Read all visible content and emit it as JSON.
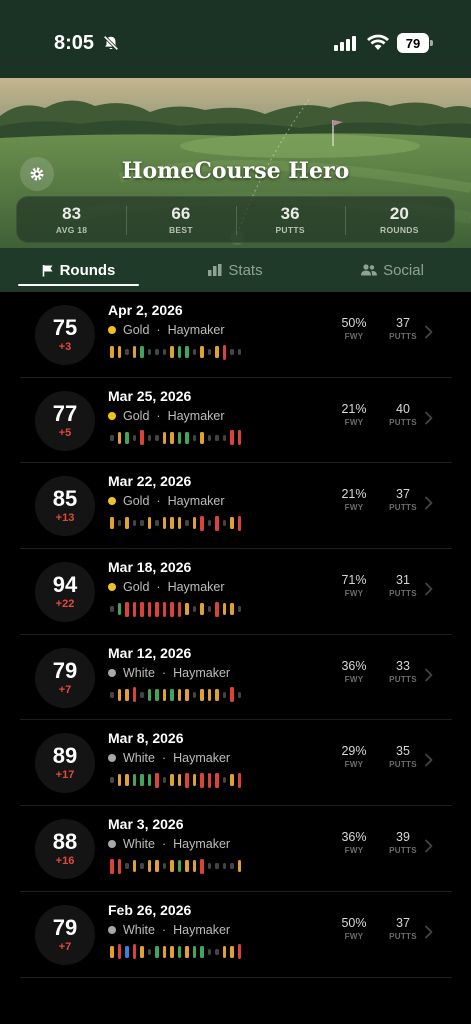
{
  "status_bar": {
    "time": "8:05",
    "battery": "79"
  },
  "app": {
    "title": "HomeCourse Hero"
  },
  "summary": [
    {
      "value": "83",
      "label": "AVG 18"
    },
    {
      "value": "66",
      "label": "BEST"
    },
    {
      "value": "36",
      "label": "PUTTS"
    },
    {
      "value": "20",
      "label": "ROUNDS"
    }
  ],
  "tabs": [
    {
      "label": "Rounds",
      "icon": "flag-icon",
      "active": true
    },
    {
      "label": "Stats",
      "icon": "bar-chart-icon",
      "active": false
    },
    {
      "label": "Social",
      "icon": "people-icon",
      "active": false
    }
  ],
  "colors": {
    "eagle": "#3b7fd6",
    "birdie": "#3fa65a",
    "par": "#444444",
    "bogey": "#e0a12f",
    "double": "#d9433a",
    "gold_tee": "#f2c21b",
    "white_tee": "#a8a8a8"
  },
  "rounds": [
    {
      "score": "75",
      "diff": "+3",
      "date": "Apr 2, 2026",
      "tee": "Gold",
      "tee_color": "#f2c21b",
      "course": "Haymaker",
      "fwy": "50%",
      "putts": "37",
      "holes": [
        "bogey",
        "bogey",
        "par",
        "bogey",
        "birdie",
        "par",
        "par",
        "par",
        "bogey",
        "birdie",
        "birdie",
        "par",
        "bogey",
        "par",
        "bogey",
        "double",
        "par",
        "par"
      ]
    },
    {
      "score": "77",
      "diff": "+5",
      "date": "Mar 25, 2026",
      "tee": "Gold",
      "tee_color": "#f2c21b",
      "course": "Haymaker",
      "fwy": "21%",
      "putts": "40",
      "holes": [
        "par",
        "bogey",
        "birdie",
        "par",
        "double",
        "par",
        "par",
        "bogey",
        "bogey",
        "birdie",
        "birdie",
        "par",
        "bogey",
        "par",
        "par",
        "par",
        "double",
        "double"
      ]
    },
    {
      "score": "85",
      "diff": "+13",
      "date": "Mar 22, 2026",
      "tee": "Gold",
      "tee_color": "#f2c21b",
      "course": "Haymaker",
      "fwy": "21%",
      "putts": "37",
      "holes": [
        "bogey",
        "par",
        "bogey",
        "par",
        "par",
        "bogey",
        "par",
        "bogey",
        "bogey",
        "bogey",
        "par",
        "bogey",
        "double",
        "par",
        "double",
        "par",
        "bogey",
        "double"
      ]
    },
    {
      "score": "94",
      "diff": "+22",
      "date": "Mar 18, 2026",
      "tee": "Gold",
      "tee_color": "#f2c21b",
      "course": "Haymaker",
      "fwy": "71%",
      "putts": "31",
      "holes": [
        "par",
        "birdie",
        "double",
        "double",
        "double",
        "double",
        "double",
        "double",
        "double",
        "double",
        "bogey",
        "par",
        "bogey",
        "par",
        "double",
        "bogey",
        "bogey",
        "par"
      ]
    },
    {
      "score": "79",
      "diff": "+7",
      "date": "Mar 12, 2026",
      "tee": "White",
      "tee_color": "#a8a8a8",
      "course": "Haymaker",
      "fwy": "36%",
      "putts": "33",
      "holes": [
        "par",
        "bogey",
        "bogey",
        "double",
        "par",
        "birdie",
        "birdie",
        "bogey",
        "birdie",
        "bogey",
        "bogey",
        "par",
        "bogey",
        "bogey",
        "bogey",
        "par",
        "double",
        "par"
      ]
    },
    {
      "score": "89",
      "diff": "+17",
      "date": "Mar 8, 2026",
      "tee": "White",
      "tee_color": "#a8a8a8",
      "course": "Haymaker",
      "fwy": "29%",
      "putts": "35",
      "holes": [
        "par",
        "bogey",
        "bogey",
        "birdie",
        "birdie",
        "birdie",
        "double",
        "par",
        "bogey",
        "bogey",
        "double",
        "bogey",
        "double",
        "double",
        "double",
        "par",
        "bogey",
        "double"
      ]
    },
    {
      "score": "88",
      "diff": "+16",
      "date": "Mar 3, 2026",
      "tee": "White",
      "tee_color": "#a8a8a8",
      "course": "Haymaker",
      "fwy": "36%",
      "putts": "39",
      "holes": [
        "double",
        "double",
        "par",
        "bogey",
        "par",
        "bogey",
        "bogey",
        "par",
        "bogey",
        "birdie",
        "bogey",
        "bogey",
        "double",
        "par",
        "par",
        "par",
        "par",
        "bogey"
      ]
    },
    {
      "score": "79",
      "diff": "+7",
      "date": "Feb 26, 2026",
      "tee": "White",
      "tee_color": "#a8a8a8",
      "course": "Haymaker",
      "fwy": "50%",
      "putts": "37",
      "holes": [
        "bogey",
        "double",
        "eagle",
        "double",
        "bogey",
        "par",
        "birdie",
        "bogey",
        "bogey",
        "birdie",
        "bogey",
        "birdie",
        "birdie",
        "par",
        "par",
        "bogey",
        "bogey",
        "double"
      ]
    }
  ],
  "labels": {
    "fwy": "FWY",
    "putts": "PUTTS",
    "separator": "·"
  }
}
